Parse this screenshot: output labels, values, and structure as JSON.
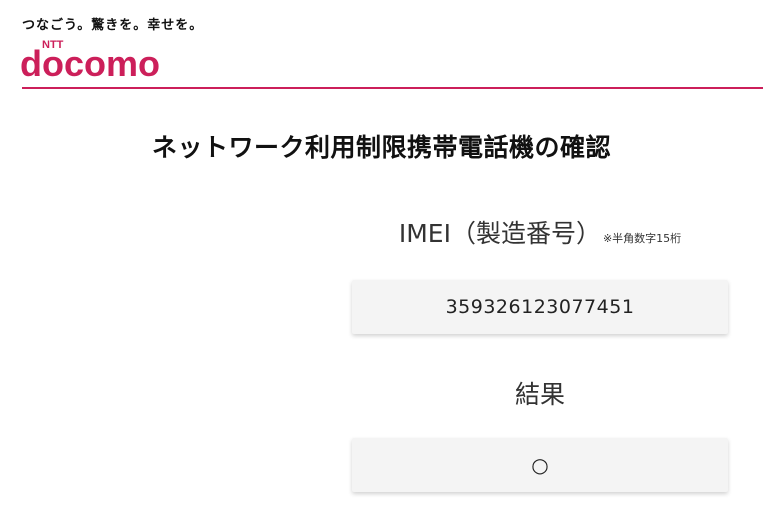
{
  "header": {
    "tagline": "つなごう。驚きを。幸せを。",
    "logo_small": "NTT",
    "logo_main": "docomo",
    "brand_color": "#cc1f5a"
  },
  "page": {
    "title": "ネットワーク利用制限携帯電話機の確認"
  },
  "imei": {
    "label": "IMEI（製造番号）",
    "note": "※半角数字15桁",
    "value": "359326123077451"
  },
  "result": {
    "label": "結果",
    "value": "○"
  }
}
